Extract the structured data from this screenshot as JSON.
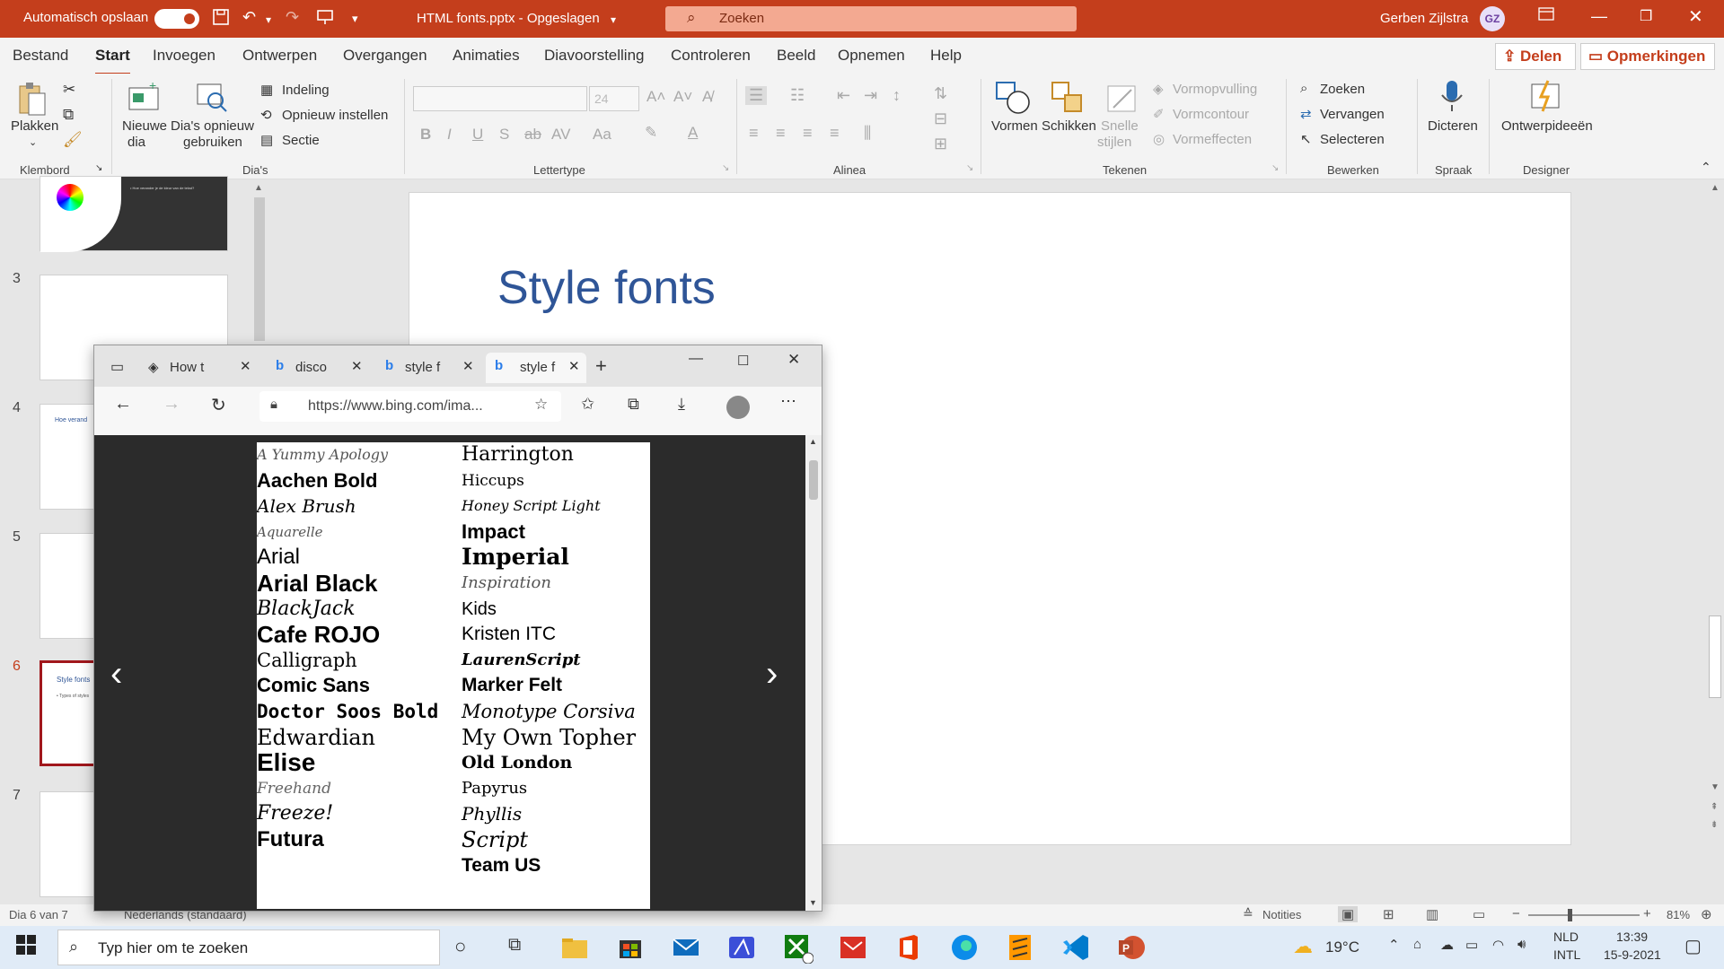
{
  "titlebar": {
    "autosave_label": "Automatisch opslaan",
    "document_title": "HTML fonts.pptx - Opgeslagen",
    "search_placeholder": "Zoeken",
    "user_name": "Gerben Zijlstra",
    "user_initials": "GZ"
  },
  "menu": {
    "items": [
      "Bestand",
      "Start",
      "Invoegen",
      "Ontwerpen",
      "Overgangen",
      "Animaties",
      "Diavoorstelling",
      "Controleren",
      "Beeld",
      "Opnemen",
      "Help"
    ],
    "active": "Start",
    "share_label": "Delen",
    "comments_label": "Opmerkingen"
  },
  "ribbon": {
    "klembord": {
      "paste": "Plakken",
      "group": "Klembord"
    },
    "dias": {
      "new_slide_1": "Nieuwe",
      "new_slide_2": "dia",
      "reuse_1": "Dia's opnieuw",
      "reuse_2": "gebruiken",
      "layout": "Indeling",
      "reset": "Opnieuw instellen",
      "section": "Sectie",
      "group": "Dia's"
    },
    "lettertype": {
      "size": "24",
      "group": "Lettertype"
    },
    "alinea": {
      "group": "Alinea"
    },
    "tekenen": {
      "shapes": "Vormen",
      "arrange": "Schikken",
      "quick_1": "Snelle",
      "quick_2": "stijlen",
      "fill": "Vormopvulling",
      "outline": "Vormcontour",
      "effects": "Vormeffecten",
      "group": "Tekenen"
    },
    "bewerken": {
      "find": "Zoeken",
      "replace": "Vervangen",
      "select": "Selecteren",
      "group": "Bewerken"
    },
    "spraak": {
      "dictate": "Dicteren",
      "group": "Spraak"
    },
    "designer": {
      "ideas": "Ontwerpideeën",
      "group": "Designer"
    }
  },
  "slides_panel": {
    "numbers": [
      "3",
      "4",
      "5",
      "6",
      "7"
    ],
    "slide4_text": "Hoe verand",
    "slide6_title": "Style fonts",
    "slide6_bullet": "• Types of styles",
    "slide2_text": "• Hoe verander je de kleur van de tekst?"
  },
  "slide": {
    "title": "Style fonts"
  },
  "browser": {
    "tabs": [
      "How t",
      "disco",
      "style f",
      "style f"
    ],
    "url": "https://www.bing.com/ima..."
  },
  "font_image": {
    "left_column": [
      "A Yummy Apology",
      "Aachen Bold",
      "Alex Brush",
      "Aquarelle",
      "Arial",
      "Arial Black",
      "BlackJack",
      "Cafe ROJO",
      "Calligraph",
      "Comic Sans",
      "Doctor Soos Bold",
      "Edwardian",
      "Elise",
      "Freehand",
      "Freeze!",
      "Futura"
    ],
    "right_column": [
      "Harrington",
      "Hiccups",
      "Honey Script Light",
      "Impact",
      "Imperial",
      "Inspiration",
      "Kids",
      "Kristen ITC",
      "LaurenScript",
      "Marker Felt",
      "Monotype Corsiva",
      "My Own Topher",
      "Old London",
      "Papyrus",
      "Phyllis",
      "Script",
      "Team US"
    ]
  },
  "statusbar": {
    "slide_info": "Dia 6 van 7",
    "language": "Nederlands (standaard)",
    "notes": "Notities",
    "zoom": "81%"
  },
  "taskbar": {
    "search_placeholder": "Typ hier om te zoeken",
    "temperature": "19°C",
    "lang1": "NLD",
    "lang2": "INTL",
    "time": "13:39",
    "date": "15-9-2021"
  },
  "colors": {
    "accent": "#c43e1c",
    "title_blue": "#2f5597"
  }
}
